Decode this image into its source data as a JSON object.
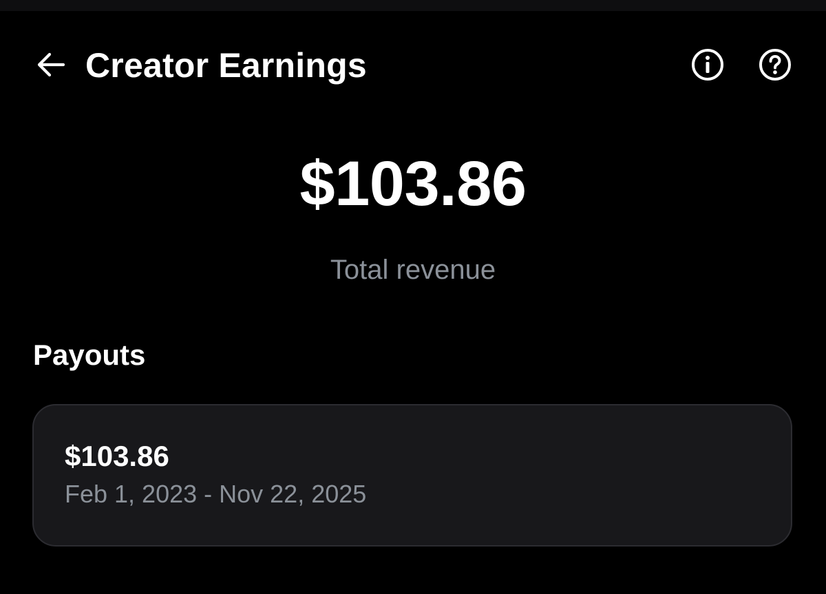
{
  "header": {
    "title": "Creator Earnings",
    "back_icon": "arrow-left-icon",
    "info_icon": "info-circle-icon",
    "help_icon": "question-circle-icon"
  },
  "summary": {
    "total_amount": "$103.86",
    "total_label": "Total revenue"
  },
  "payouts": {
    "section_title": "Payouts",
    "items": [
      {
        "amount": "$103.86",
        "date_range": "Feb 1, 2023 - Nov 22, 2025"
      }
    ]
  },
  "colors": {
    "background": "#000000",
    "text_primary": "#ffffff",
    "text_secondary": "#8b9199",
    "card_background": "#18181b",
    "card_border": "#2c2c31"
  }
}
